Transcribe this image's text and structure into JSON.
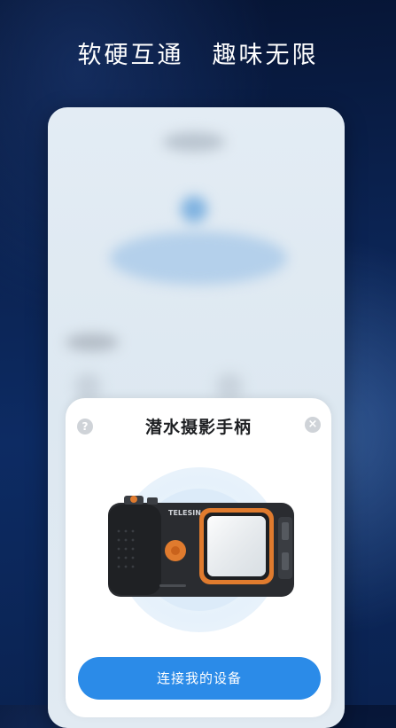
{
  "headline": {
    "part1": "软硬互通",
    "part2": "趣味无限"
  },
  "sheet": {
    "title": "潜水摄影手柄",
    "help_symbol": "?",
    "close_symbol": "×",
    "connect_button": "连接我的设备"
  },
  "product": {
    "brand": "TELESIN"
  },
  "icons": {
    "help": "help-icon",
    "close": "close-icon"
  },
  "colors": {
    "background": "#0b2352",
    "primary_button": "#2b8be8",
    "device_accent": "#e07b2e"
  }
}
